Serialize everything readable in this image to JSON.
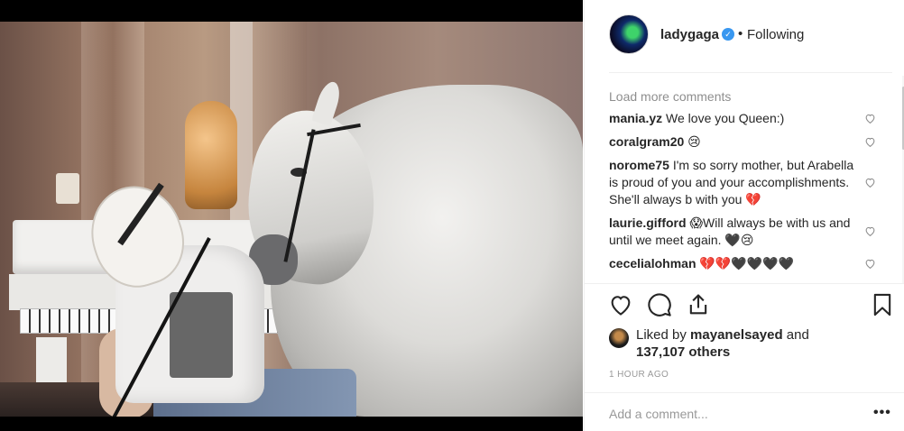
{
  "header": {
    "username": "ladygaga",
    "verified_mark": "✓",
    "separator": "•",
    "follow_status": "Following"
  },
  "comments": {
    "load_more": "Load more comments",
    "items": [
      {
        "user": "mania.yz",
        "text": "We love you Queen:)"
      },
      {
        "user": "coralgram20",
        "text": "😢"
      },
      {
        "user": "norome75",
        "text": "I'm so sorry mother, but Arabella is proud of you and your accomplishments. She'll always b with you 💔"
      },
      {
        "user": "laurie.gifford",
        "text": "😱Will always be with us and until we meet again. 🖤😢"
      },
      {
        "user": "cecelialohman",
        "text": "💔💔🖤🖤🖤🖤"
      }
    ]
  },
  "actions": {
    "like_icon": "heart-icon",
    "comment_icon": "comment-icon",
    "share_icon": "share-icon",
    "save_icon": "bookmark-icon"
  },
  "likes": {
    "prefix": "Liked by",
    "user": "mayanelsayed",
    "connector": "and",
    "others": "137,107 others"
  },
  "timestamp": "1 HOUR AGO",
  "add_comment": {
    "placeholder": "Add a comment...",
    "more": "•••"
  }
}
